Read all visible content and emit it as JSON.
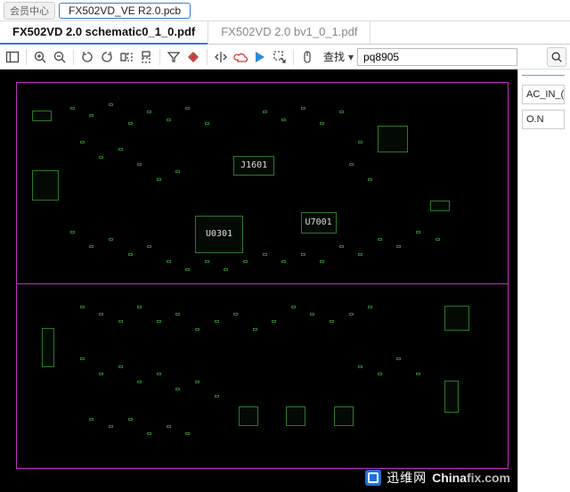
{
  "header": {
    "member_center": "会员中心",
    "main_tab": "FX502VD_VE R2.0.pcb"
  },
  "doc_tabs": [
    {
      "label": "FX502VD 2.0 schematic0_1_0.pdf",
      "active": true
    },
    {
      "label": "FX502VD 2.0 bv1_0_1.pdf",
      "active": false
    }
  ],
  "toolbar": {
    "search_label": "查找",
    "search_value": "pq8905"
  },
  "side_panel": {
    "row1": "AC_IN_(",
    "row2": "O.N"
  },
  "board": {
    "labels": {
      "u0301": "U0301",
      "j1601": "J1601",
      "u7001": "U7001"
    }
  },
  "watermark": {
    "cn": "迅维网",
    "en_a": "China",
    "en_b": "fix",
    "en_c": ".com"
  }
}
